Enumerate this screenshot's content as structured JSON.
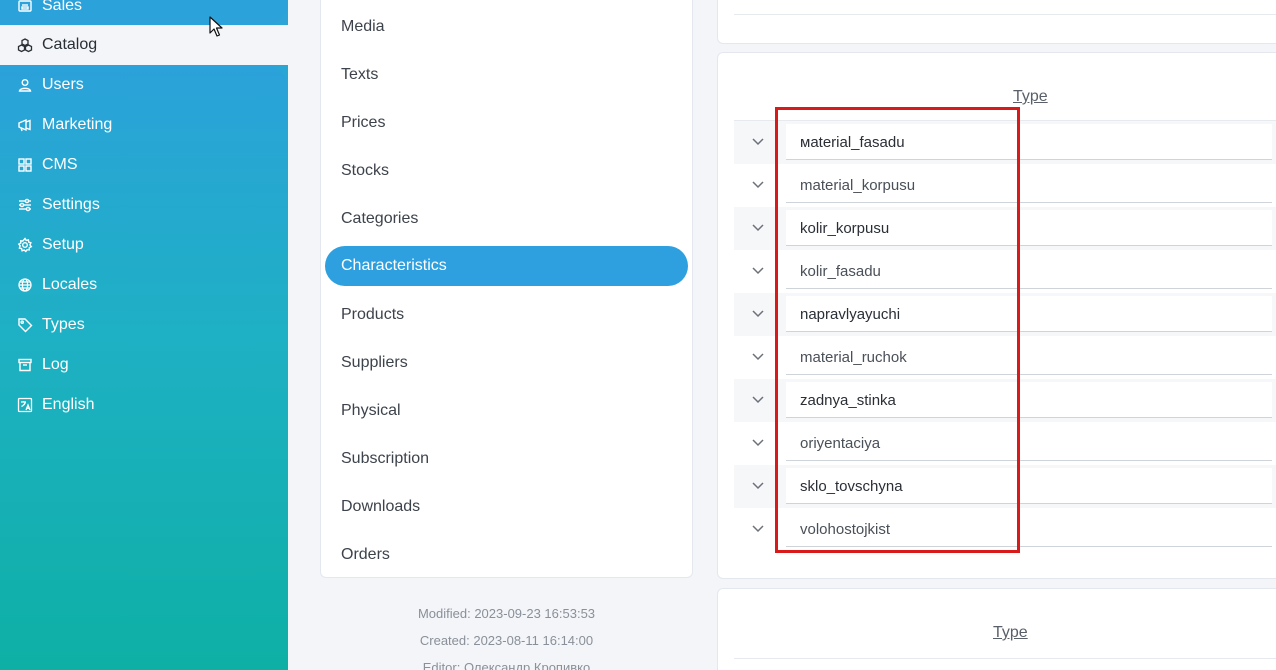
{
  "nav": {
    "items": [
      {
        "label": "Sales",
        "icon": "register-icon"
      },
      {
        "label": "Catalog",
        "icon": "cubes-icon"
      },
      {
        "label": "Users",
        "icon": "user-icon"
      },
      {
        "label": "Marketing",
        "icon": "megaphone-icon"
      },
      {
        "label": "CMS",
        "icon": "grid-icon"
      },
      {
        "label": "Settings",
        "icon": "sliders-icon"
      },
      {
        "label": "Setup",
        "icon": "gear-icon"
      },
      {
        "label": "Locales",
        "icon": "globe-icon"
      },
      {
        "label": "Types",
        "icon": "tag-icon"
      },
      {
        "label": "Log",
        "icon": "archive-icon"
      },
      {
        "label": "English",
        "icon": "translate-icon"
      }
    ],
    "active": "Catalog"
  },
  "submenu": {
    "items": [
      "Media",
      "Texts",
      "Prices",
      "Stocks",
      "Categories",
      "Characteristics",
      "Products",
      "Suppliers",
      "Physical",
      "Subscription",
      "Downloads",
      "Orders"
    ],
    "active": "Characteristics"
  },
  "meta": {
    "modified": "Modified: 2023-09-23 16:53:53",
    "created": "Created: 2023-08-11 16:14:00",
    "editor": "Editor: Олександр Кропивко"
  },
  "table": {
    "header": "Type",
    "rows": [
      "мaterial_fasadu",
      "material_korpusu",
      "kolir_korpusu",
      "kolir_fasadu",
      "napravlyayuchi",
      "material_ruchok",
      "zadnya_stinka",
      "oriyentaciya",
      "sklo_tovschyna",
      "volohostojkist"
    ]
  },
  "table2": {
    "header": "Type"
  },
  "colors": {
    "accent": "#2e9fdf",
    "nav_top": "#2ba2da",
    "nav_bottom": "#0eb0a5",
    "highlight": "#d91a1a"
  }
}
